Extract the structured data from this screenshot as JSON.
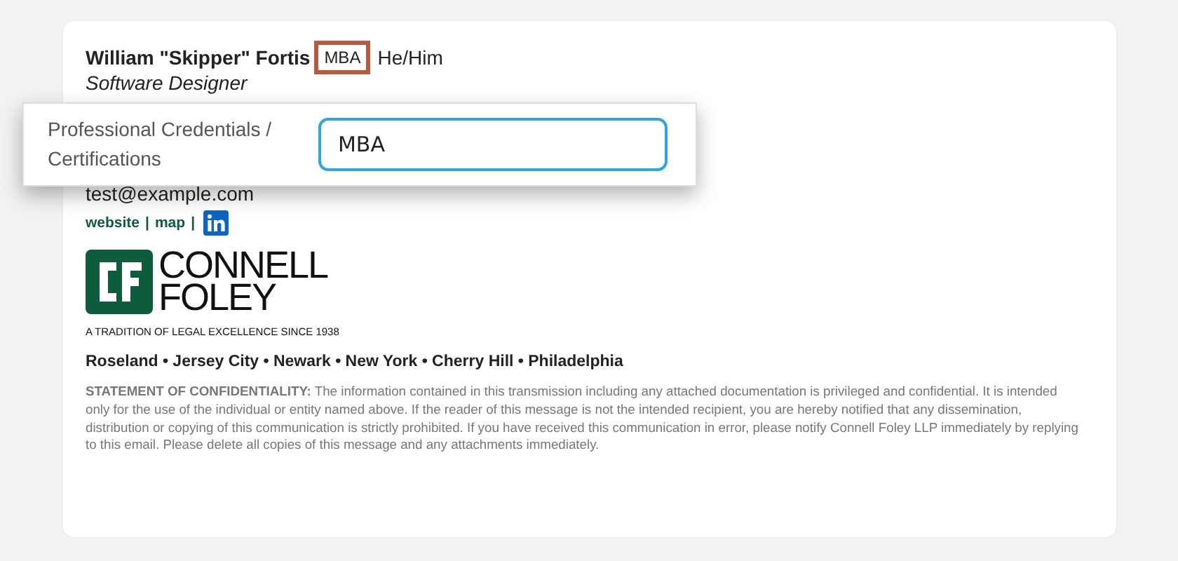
{
  "signature": {
    "name": "William \"Skipper\" Fortis",
    "credentials": "MBA",
    "credentials_highlighted": true,
    "pronouns": "He/Him",
    "title": "Software Designer",
    "email": "test@example.com",
    "links": [
      {
        "label": "website",
        "separator": "|"
      },
      {
        "label": "map",
        "separator": "|"
      }
    ],
    "logo": {
      "line_1": "CONNELL",
      "line_2": "FOLEY",
      "tagline": "A TRADITION OF LEGAL EXCELLENCE SINCE 1938"
    },
    "offices": "Roseland • Jersey City • Newark • New York • Cherry Hill • Philadelphia",
    "disclaimer": "**STATEMENT OF CONFIDENTIALITY:**  The information contained in this transmission including any attached documentation is privileged and confidential. It is intended only for the use of the individual or entity named above. If the reader of this message is not the intended recipient, you are hereby notified that any dissemination, distribution or copying of this communication is strictly prohibited. If you have received this communication in error, please notify Connell Foley LLP immediately by replying to this email. Please delete all copies of this message and any attachments immediately."
  },
  "popup": {
    "label": "Professional Credentials / Certifications",
    "value": "MBA",
    "focused": true
  }
}
